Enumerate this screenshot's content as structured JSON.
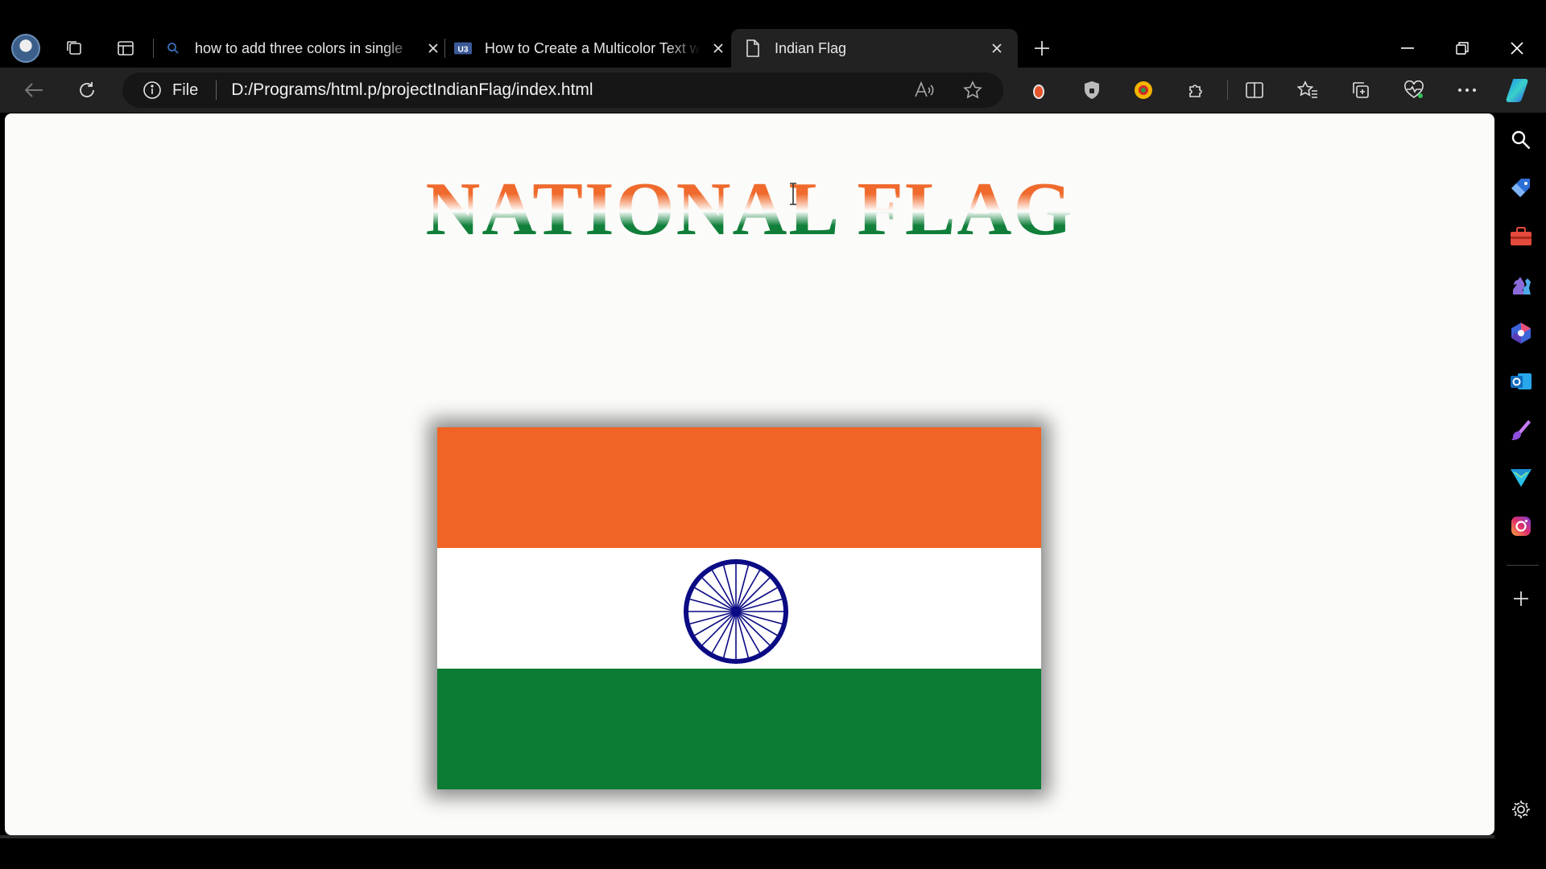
{
  "browser": {
    "tabs": [
      {
        "title": "how to add three colors in single",
        "icon": "search-icon",
        "active": false
      },
      {
        "title": "How to Create a Multicolor Text w",
        "icon": "site-favicon-icon",
        "active": false
      },
      {
        "title": "Indian Flag",
        "icon": "document-icon",
        "active": true
      }
    ],
    "address": {
      "scheme_label": "File",
      "url": "D:/Programs/html.p/projectIndianFlag/index.html"
    }
  },
  "page": {
    "heading": "NATIONAL FLAG",
    "flag": {
      "colors": {
        "saffron": "#f06425",
        "white": "#ffffff",
        "green": "#0c7c35",
        "chakra": "#0b0b84"
      },
      "chakra_spokes": 24
    }
  }
}
